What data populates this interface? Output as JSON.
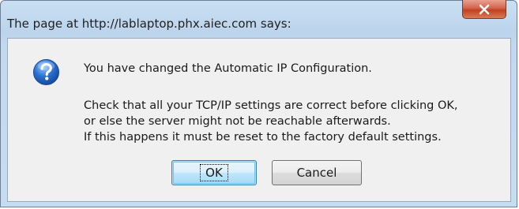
{
  "window": {
    "title": "The page at http://lablaptop.phx.aiec.com says:"
  },
  "titlebar": {
    "close_icon": "close-x-icon"
  },
  "dialog": {
    "icon": "question-icon",
    "message_line_1": "You have changed the Automatic IP Configuration.",
    "message_line_2": "Check that all your TCP/IP settings are correct before clicking OK,",
    "message_line_3": "or else the server might not be reachable afterwards.",
    "message_line_4": "If this happens it must be reset to the factory default settings."
  },
  "buttons": {
    "ok_label": "OK",
    "cancel_label": "Cancel"
  },
  "colors": {
    "frame": "#c6dcf1",
    "close_button": "#c9472a",
    "client_background": "#f0f0f0",
    "question_icon": "#2a6fd0"
  }
}
